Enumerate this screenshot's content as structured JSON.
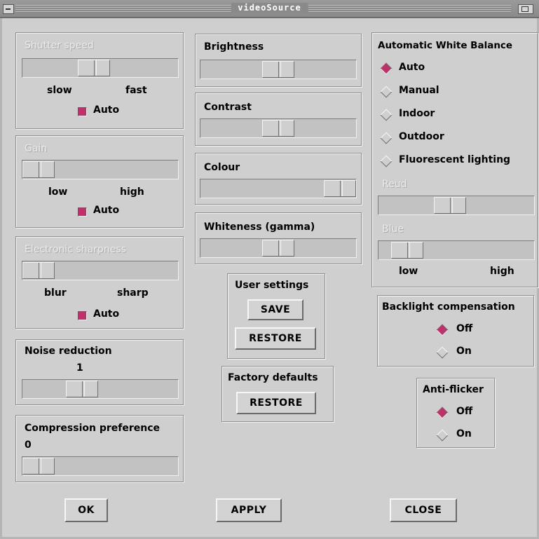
{
  "window": {
    "title": "videoSource"
  },
  "shutter": {
    "title": "Shutter speed",
    "left": "slow",
    "right": "fast",
    "auto": "Auto",
    "auto_checked": true,
    "position": 0.45
  },
  "gain": {
    "title": "Gain",
    "left": "low",
    "right": "high",
    "auto": "Auto",
    "auto_checked": true,
    "position": 0.0
  },
  "sharpness": {
    "title": "Electronic sharpness",
    "left": "blur",
    "right": "sharp",
    "auto": "Auto",
    "auto_checked": true,
    "position": 0.0
  },
  "noise": {
    "title": "Noise reduction",
    "value": "1",
    "position": 0.35
  },
  "compression": {
    "title": "Compression preference",
    "value": "0",
    "position": 0.0
  },
  "brightness": {
    "title": "Brightness",
    "position": 0.5
  },
  "contrast": {
    "title": "Contrast",
    "position": 0.5
  },
  "colour": {
    "title": "Colour",
    "position": 1.0
  },
  "whiteness": {
    "title": "Whiteness (gamma)",
    "position": 0.5
  },
  "user_settings": {
    "title": "User settings",
    "save": "SAVE",
    "restore": "RESTORE"
  },
  "factory_defaults": {
    "title": "Factory defaults",
    "restore": "RESTORE"
  },
  "awb": {
    "title": "Automatic White Balance",
    "options": [
      "Auto",
      "Manual",
      "Indoor",
      "Outdoor",
      "Fluorescent lighting"
    ],
    "selected": "Auto",
    "red": "Reud",
    "blue": "Blue",
    "red_position": 0.45,
    "blue_position": 0.1,
    "low": "low",
    "high": "high"
  },
  "backlight": {
    "title": "Backlight compensation",
    "options": [
      "Off",
      "On"
    ],
    "selected": "Off"
  },
  "antiflicker": {
    "title": "Anti-flicker",
    "options": [
      "Off",
      "On"
    ],
    "selected": "Off"
  },
  "footer": {
    "ok": "OK",
    "apply": "APPLY",
    "close": "CLOSE"
  },
  "colors": {
    "accent": "#c0306a",
    "background": "#cfcfcf"
  }
}
